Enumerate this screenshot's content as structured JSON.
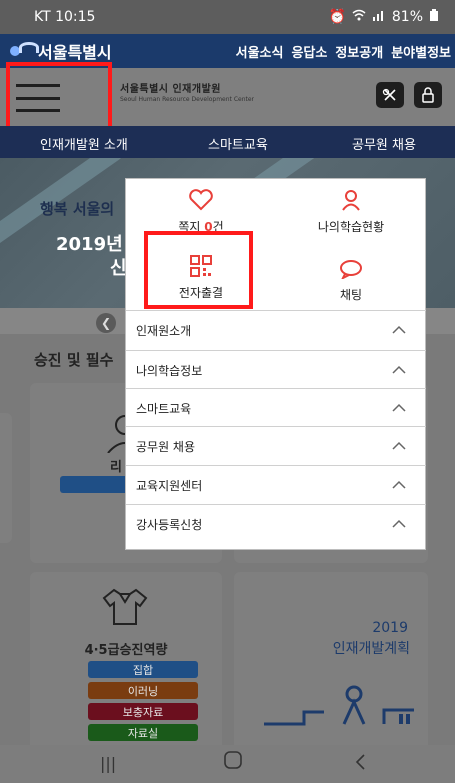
{
  "status": {
    "carrier_time": "KT 10:15",
    "battery": "81%"
  },
  "topbar": {
    "city_name": "서울특별시",
    "links": [
      "서울소식",
      "응답소",
      "정보공개",
      "분야별정보"
    ]
  },
  "header": {
    "site_name": "서울특별시 인재개발원",
    "site_name_en": "Seoul Human Resource Development Center",
    "icons": [
      "menu-icon",
      "link-icon",
      "lock-icon"
    ]
  },
  "nav": {
    "items": [
      "인재개발원 소개",
      "스마트교육",
      "공무원 채용"
    ]
  },
  "banner": {
    "line1": "행복 서울의",
    "line2": "2019년",
    "line3": "신"
  },
  "section": {
    "title": "승진 및 필수"
  },
  "cards": {
    "card1_label": "리",
    "card1_badge": "집",
    "card3_title": "4·5급승진역량",
    "card3_buttons": [
      "집합",
      "이러닝",
      "보충자료",
      "자료실"
    ],
    "card3_button_colors": [
      "#1f4f86",
      "#7a3c10",
      "#6b0f1e",
      "#1a5a1a"
    ],
    "card4_year": "2019",
    "card4_title": "인재개발계획"
  },
  "quick_menu": {
    "note_label": "쪽지",
    "note_count": "0",
    "note_suffix": "건",
    "learning_status": "나의학습현황",
    "e_attendance": "전자출결",
    "chat": "채팅"
  },
  "menu": {
    "items": [
      "인재원소개",
      "나의학습정보",
      "스마트교육",
      "공무원 채용",
      "교육지원센터",
      "강사등록신청"
    ]
  },
  "colors": {
    "accent_red": "#e8403a",
    "highlight": "#ff1a1a"
  }
}
